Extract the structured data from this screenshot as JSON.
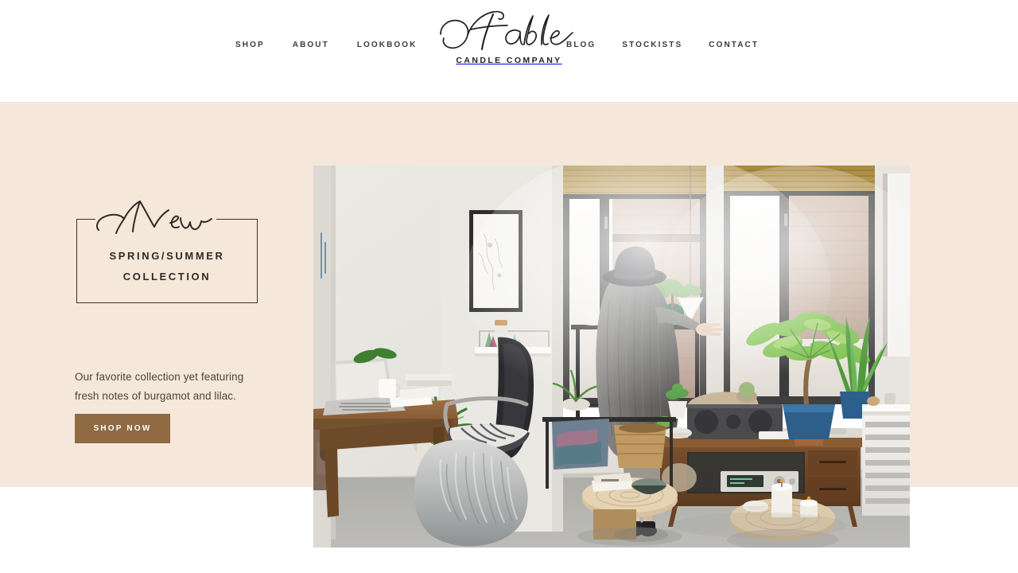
{
  "brand": {
    "script_name": "Fable",
    "tagline": "CANDLE COMPANY"
  },
  "nav": {
    "left_items": [
      {
        "label": "SHOP"
      },
      {
        "label": "ABOUT"
      },
      {
        "label": "LOOKBOOK"
      }
    ],
    "right_items": [
      {
        "label": "BLOG"
      },
      {
        "label": "STOCKISTS"
      },
      {
        "label": "CONTACT"
      }
    ]
  },
  "hero": {
    "background_color": "#F6E7DB",
    "badge": {
      "script_word": "New",
      "line1": "SPRING/SUMMER",
      "line2": "COLLECTION"
    },
    "description": "Our favorite collection yet featuring fresh notes of burgamot and lilac.",
    "cta": {
      "label": "SHOP NOW",
      "color": "#8F6A42",
      "text_color": "#FFFFFF"
    },
    "photo": {
      "alt": "Woman in wide-brim hat and grey knit cardigan standing by a sunlit loft window with houseplants, mid-century credenza, wooden desk with laptop and Eames chair"
    }
  },
  "colors": {
    "page_background": "#FFFFFF",
    "hero_background": "#F6E7DB",
    "ink": "#2B2B2B",
    "accent_brown": "#8F6A42"
  }
}
